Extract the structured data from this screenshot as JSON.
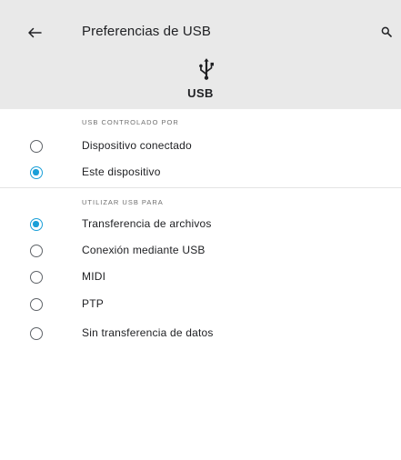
{
  "header": {
    "title": "Preferencias de USB",
    "usb_label": "USB",
    "background": "#e9e9e9"
  },
  "sections": [
    {
      "header": "USB CONTROLADO POR",
      "options": [
        {
          "label": "Dispositivo conectado",
          "checked": false
        },
        {
          "label": "Este dispositivo",
          "checked": true
        }
      ]
    },
    {
      "header": "UTILIZAR USB PARA",
      "options": [
        {
          "label": "Transferencia de archivos",
          "checked": true
        },
        {
          "label": "Conexión mediante USB",
          "checked": false
        },
        {
          "label": "MIDI",
          "checked": false
        },
        {
          "label": "PTP",
          "checked": false
        },
        {
          "label": "Sin transferencia de datos",
          "checked": false
        }
      ]
    }
  ],
  "icons": {
    "back": "arrow-back-icon",
    "search": "search-icon",
    "usb": "usb-icon"
  },
  "colors": {
    "accent": "#1a9fd8"
  }
}
